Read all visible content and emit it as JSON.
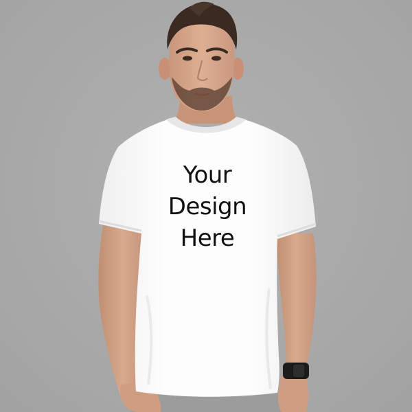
{
  "print_area": {
    "lines": [
      "Your",
      "Design",
      "Here"
    ]
  },
  "colors": {
    "background": "#a9a9a9",
    "shirt": "#fbfbfb",
    "skin": "#d3a386",
    "hair": "#3a2a22",
    "pants": "#9c9c9c",
    "watch": "#1c1c1c",
    "print_text": "#111111"
  },
  "subject": {
    "garment": "white crew-neck t-shirt",
    "accessory_icon": "wristwatch-icon"
  }
}
